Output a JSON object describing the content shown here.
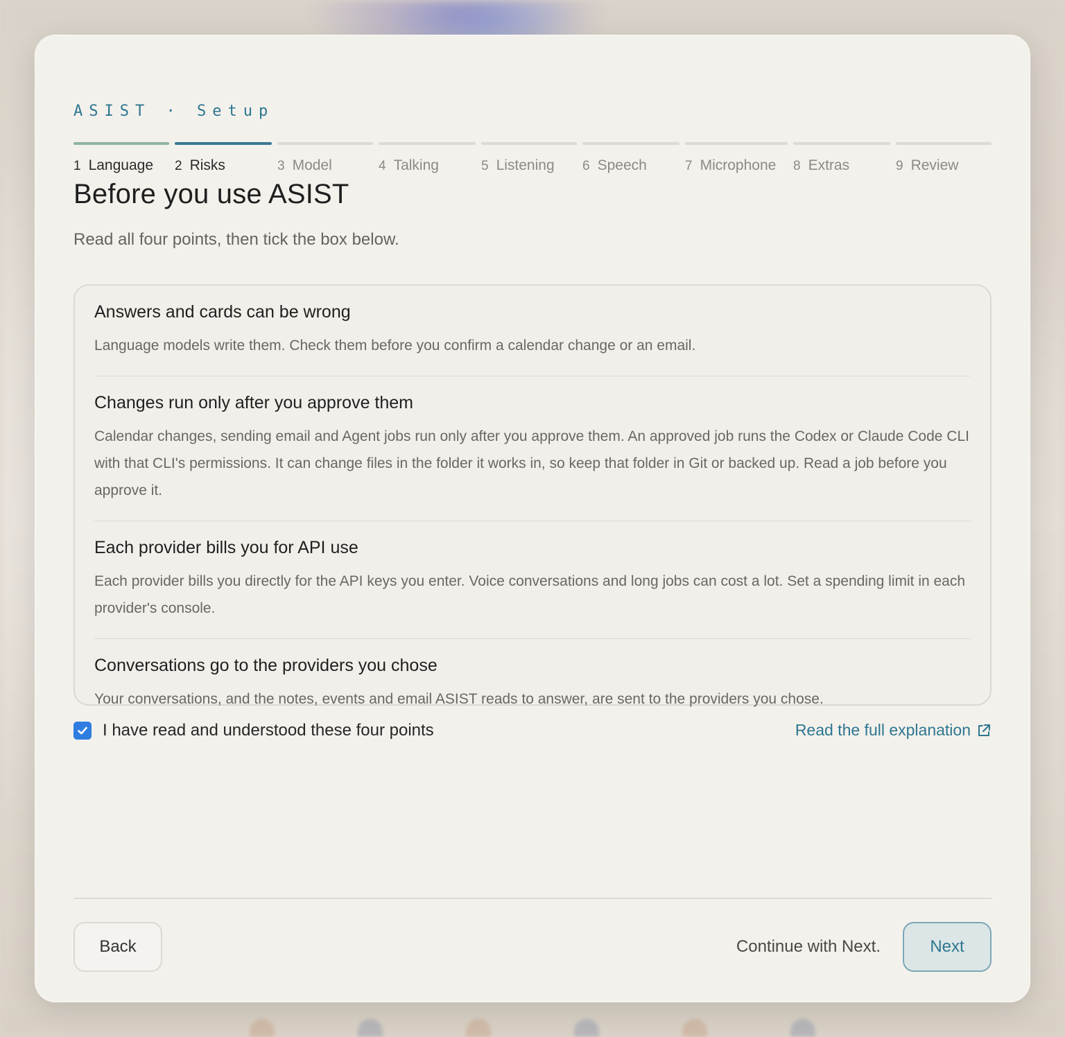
{
  "brand": "ASIST · Setup",
  "steps": [
    {
      "num": "1",
      "label": "Language",
      "state": "done"
    },
    {
      "num": "2",
      "label": "Risks",
      "state": "active"
    },
    {
      "num": "3",
      "label": "Model",
      "state": "todo"
    },
    {
      "num": "4",
      "label": "Talking",
      "state": "todo"
    },
    {
      "num": "5",
      "label": "Listening",
      "state": "todo"
    },
    {
      "num": "6",
      "label": "Speech",
      "state": "todo"
    },
    {
      "num": "7",
      "label": "Microphone",
      "state": "todo"
    },
    {
      "num": "8",
      "label": "Extras",
      "state": "todo"
    },
    {
      "num": "9",
      "label": "Review",
      "state": "todo"
    }
  ],
  "page": {
    "title": "Before you use ASIST",
    "subtitle": "Read all four points, then tick the box below."
  },
  "points": [
    {
      "title": "Answers and cards can be wrong",
      "body": "Language models write them. Check them before you confirm a calendar change or an email."
    },
    {
      "title": "Changes run only after you approve them",
      "body": "Calendar changes, sending email and Agent jobs run only after you approve them. An approved job runs the Codex or Claude Code CLI with that CLI's permissions. It can change files in the folder it works in, so keep that folder in Git or backed up. Read a job before you approve it."
    },
    {
      "title": "Each provider bills you for API use",
      "body": "Each provider bills you directly for the API keys you enter. Voice conversations and long jobs can cost a lot. Set a spending limit in each provider's console."
    },
    {
      "title": "Conversations go to the providers you chose",
      "body": "Your conversations, and the notes, events and email ASIST reads to answer, are sent to the providers you chose."
    }
  ],
  "ack": {
    "label": "I have read and understood these four points",
    "checked": true
  },
  "link": {
    "label": "Read the full explanation",
    "icon": "external-link-icon"
  },
  "footer": {
    "back_label": "Back",
    "hint": "Continue with Next.",
    "next_label": "Next"
  },
  "colors": {
    "accent": "#2d7690",
    "checkbox": "#2f7de1",
    "done_bar": "#8fb4a5",
    "active_bar": "#3a7891"
  }
}
